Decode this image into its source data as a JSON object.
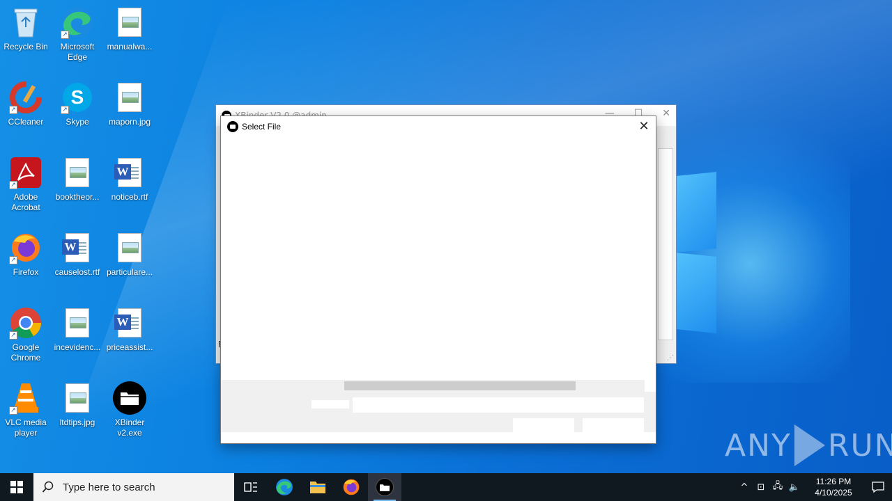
{
  "desktop": {
    "icons": [
      {
        "label": "Recycle Bin"
      },
      {
        "label": "Microsoft Edge"
      },
      {
        "label": "manualwa..."
      },
      {
        "label": "CCleaner"
      },
      {
        "label": "Skype"
      },
      {
        "label": "maporn.jpg"
      },
      {
        "label": "Adobe Acrobat"
      },
      {
        "label": "booktheor..."
      },
      {
        "label": "noticeb.rtf"
      },
      {
        "label": "Firefox"
      },
      {
        "label": "causelost.rtf"
      },
      {
        "label": "particulare..."
      },
      {
        "label": "Google Chrome"
      },
      {
        "label": "incevidenc..."
      },
      {
        "label": "priceassist..."
      },
      {
        "label": "VLC media player"
      },
      {
        "label": "ltdtips.jpg"
      },
      {
        "label": "XBinder v2.exe"
      }
    ]
  },
  "background_window": {
    "title": "XBinder V2.0 @admin",
    "status_text": "F"
  },
  "dialog": {
    "title": "Select File",
    "close_glyph": "✕"
  },
  "watermark": {
    "left": "ANY",
    "right": "RUN"
  },
  "taskbar": {
    "search_placeholder": "Type here to search",
    "clock_time": "11:26 PM",
    "clock_date": "4/10/2025"
  }
}
